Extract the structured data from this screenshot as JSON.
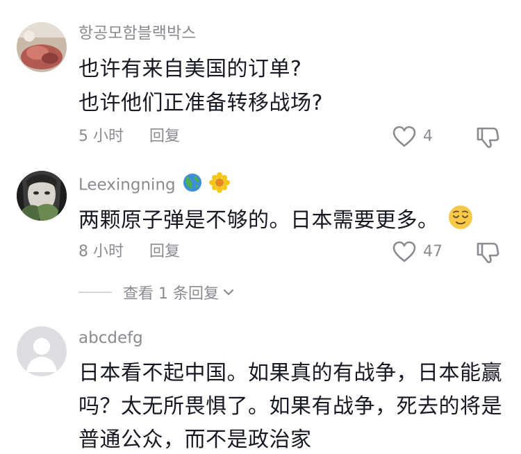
{
  "comments": [
    {
      "username": "항공모함블랙박스",
      "lines": [
        "也许有来自美国的订单?",
        "也许他们正准备转移战场?"
      ],
      "time": "5 小时",
      "reply_label": "回复",
      "likes": "4"
    },
    {
      "username": "Leexingning",
      "username_emojis": [
        "globe-icon",
        "flower-icon"
      ],
      "lines": [
        "两颗原子弹是不够的。日本需要更多。"
      ],
      "line_emoji": "relieved-face-icon",
      "time": "8 小时",
      "reply_label": "回复",
      "likes": "47",
      "view_replies": "查看 1 条回复"
    },
    {
      "username": "abcdefg",
      "lines": [
        "日本看不起中国。如果真的有战争，日本能赢",
        "吗？太无所畏惧了。如果有战争，死去的将是",
        "普通公众，而不是政治家"
      ]
    }
  ],
  "colors": {
    "text_primary": "#161823",
    "text_secondary": "#8a8b91",
    "divider": "#d6d6d8",
    "icon": "#8a8b91"
  }
}
